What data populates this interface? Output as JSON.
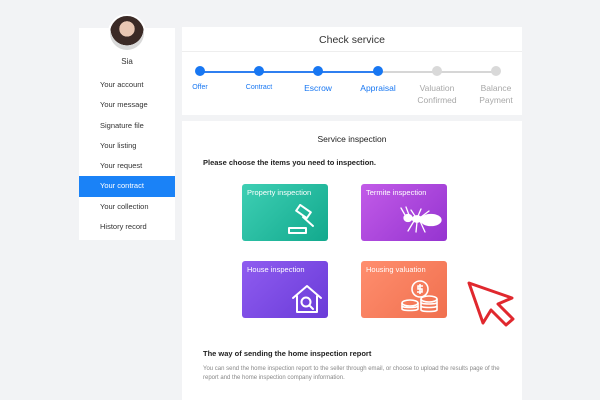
{
  "user": {
    "name": "Sia"
  },
  "sidebar": {
    "items": [
      {
        "label": "Your account"
      },
      {
        "label": "Your message"
      },
      {
        "label": "Signature file"
      },
      {
        "label": "Your listing"
      },
      {
        "label": "Your request"
      },
      {
        "label": "Your contract",
        "active": true
      },
      {
        "label": "Your collection"
      },
      {
        "label": "History record"
      }
    ]
  },
  "progress": {
    "title": "Check service",
    "steps": [
      {
        "label": "Offer",
        "done": true
      },
      {
        "label": "Contract",
        "done": true
      },
      {
        "label": "Escrow",
        "done": true
      },
      {
        "label": "Appraisal",
        "done": true
      },
      {
        "label": "Valuation Confirmed",
        "line1": "Valuation",
        "line2": "Confirmed",
        "done": false
      },
      {
        "label": "Balance Payment",
        "line1": "Balance",
        "line2": "Payment",
        "done": false
      }
    ]
  },
  "service": {
    "title": "Service inspection",
    "prompt": "Please choose the items you need to inspection.",
    "tiles": [
      {
        "label": "Property inspection",
        "icon": "gavel-icon"
      },
      {
        "label": "Termite inspection",
        "icon": "termite-icon"
      },
      {
        "label": "House inspection",
        "icon": "house-search-icon"
      },
      {
        "label": "Housing valuation",
        "icon": "coins-icon"
      }
    ],
    "sending_title": "The way of sending the home inspection report",
    "sending_desc": "You can send  the home inspection report to the seller through email, or choose to upload the results page of the report and the home inspection company information."
  },
  "colors": {
    "accent": "#1877f2",
    "inactive": "#d9d9d9",
    "cursor": "#e0282e"
  }
}
